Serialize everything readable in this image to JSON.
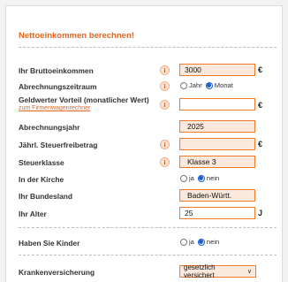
{
  "form": {
    "title": "Nettoeinkommen berechnen!",
    "info_glyph": "i",
    "rows": {
      "brutto": {
        "label": "Ihr Bruttoeinkommen",
        "value": "3000",
        "unit": "€"
      },
      "zeitraum": {
        "label": "Abrechnungszeitraum",
        "options": [
          "Jahr",
          "Monat"
        ],
        "selected": "Monat"
      },
      "geldwert": {
        "label": "Geldwerter Vorteil (monatlicher Wert)",
        "link": "zum Firmenwagenrechner",
        "value": "",
        "unit": "€"
      },
      "jahr": {
        "label": "Abrechnungsjahr",
        "value": "2025"
      },
      "freibetrag": {
        "label": "Jährl. Steuerfreibetrag",
        "value": "",
        "unit": "€"
      },
      "steuerklasse": {
        "label": "Steuerklasse",
        "value": "Klasse 3"
      },
      "kirche": {
        "label": "In der Kirche",
        "options": [
          "ja",
          "nein"
        ],
        "selected": "nein"
      },
      "bundesland": {
        "label": "Ihr Bundesland",
        "value": "Baden-Württ."
      },
      "alter": {
        "label": "Ihr Alter",
        "value": "25",
        "unit": "J"
      },
      "kinder": {
        "label": "Haben Sie Kinder",
        "options": [
          "ja",
          "nein"
        ],
        "selected": "nein"
      },
      "kv": {
        "label": "Krankenversicherung",
        "value": "gesetzlich versichert"
      }
    }
  },
  "colors": {
    "accent": "#e4651e",
    "field_bg": "#fbe8dc",
    "field_border": "#f07a2a",
    "radio_on": "#1a5fd6"
  }
}
